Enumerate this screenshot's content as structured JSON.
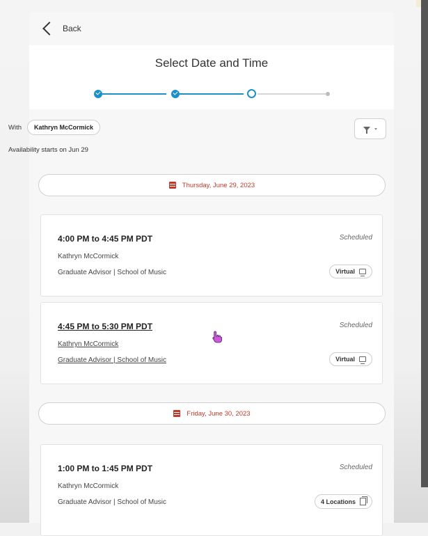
{
  "nav": {
    "back_label": "Back"
  },
  "page": {
    "title": "Select Date and Time"
  },
  "advisor": {
    "with_label": "With",
    "name": "Kathryn McCormick"
  },
  "availability_text": "Availability starts on Jun 29",
  "stepper": {
    "steps": [
      "complete",
      "complete",
      "current",
      "upcoming"
    ]
  },
  "colors": {
    "accent": "#1b8fc8",
    "date_red": "#c0392b",
    "cursor": "#c85bd8"
  },
  "days": [
    {
      "date_label": "Thursday, June 29, 2023",
      "slots": [
        {
          "time": "4:00 PM to 4:45 PM PDT",
          "status": "Scheduled",
          "name": "Kathryn McCormick",
          "role": "Graduate Advisor | School of Music",
          "badge": "Virtual"
        },
        {
          "time": "4:45 PM to 5:30 PM PDT",
          "status": "Scheduled",
          "name": "Kathryn McCormick",
          "role": "Graduate Advisor | School of Music",
          "badge": "Virtual"
        }
      ]
    },
    {
      "date_label": "Friday, June 30, 2023",
      "slots": [
        {
          "time": "1:00 PM to 1:45 PM PDT",
          "status": "Scheduled",
          "name": "Kathryn McCormick",
          "role": "Graduate Advisor | School of Music",
          "badge": "4 Locations"
        }
      ]
    }
  ]
}
